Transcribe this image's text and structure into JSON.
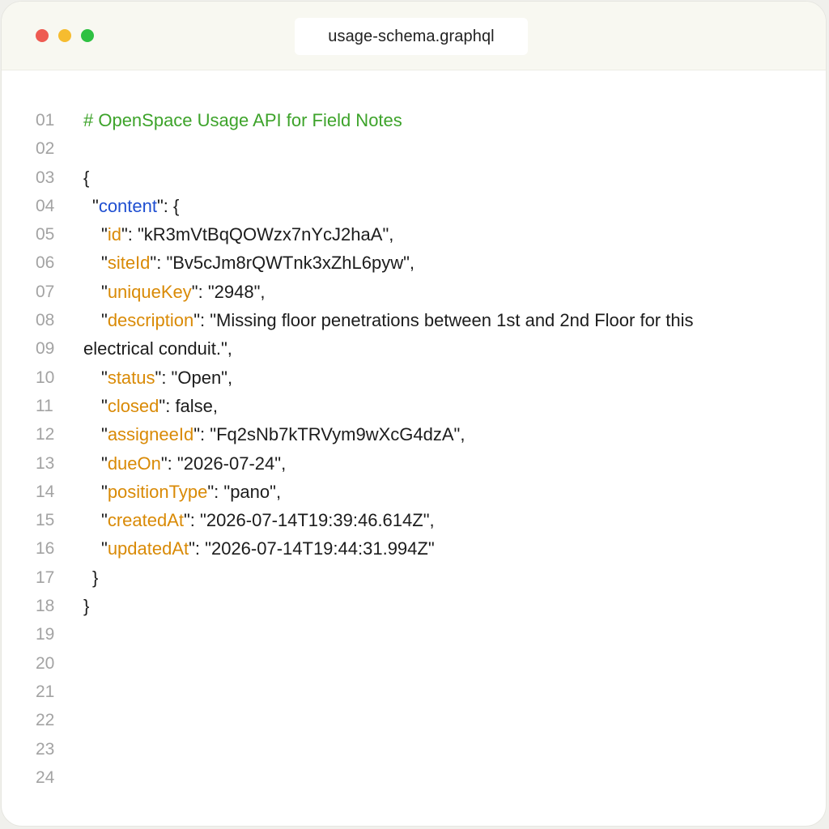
{
  "window": {
    "tab_title": "usage-schema.graphql",
    "colors": {
      "close": "#ee5b52",
      "minimize": "#f6bc2f",
      "maximize": "#2ec142"
    }
  },
  "editor": {
    "line_numbers": [
      "01",
      "02",
      "03",
      "04",
      "05",
      "06",
      "07",
      "08",
      "09",
      "10",
      "11",
      "12",
      "13",
      "14",
      "15",
      "16",
      "17",
      "18",
      "19",
      "20",
      "21",
      "22",
      "23",
      "24"
    ],
    "comment": "# OpenSpace Usage API for Field Notes",
    "open_brace": "{",
    "content_key": "content",
    "content_open": "\": {",
    "fields": {
      "id": {
        "key": "id",
        "value": "\": \"kR3mVtBqQOWzx7nYcJ2haA\","
      },
      "siteId": {
        "key": "siteId",
        "value": "\": \"Bv5cJm8rQWTnk3xZhL6pyw\","
      },
      "uniqueKey": {
        "key": "uniqueKey",
        "value": "\": \"2948\","
      },
      "description": {
        "key": "description",
        "value": "\": \"Missing floor penetrations between 1st and 2nd Floor for this",
        "continuation": "electrical conduit.\","
      },
      "status": {
        "key": "status",
        "value": "\": \"Open\","
      },
      "closed": {
        "key": "closed",
        "value": "\": false,"
      },
      "assigneeId": {
        "key": "assigneeId",
        "value": "\": \"Fq2sNb7kTRVym9wXcG4dzA\","
      },
      "dueOn": {
        "key": "dueOn",
        "value": "\": \"2026-07-24\","
      },
      "positionType": {
        "key": "positionType",
        "value": "\": \"pano\","
      },
      "createdAt": {
        "key": "createdAt",
        "value": "\": \"2026-07-14T19:39:46.614Z\","
      },
      "updatedAt": {
        "key": "updatedAt",
        "value": "\": \"2026-07-14T19:44:31.994Z\""
      }
    },
    "inner_close": "}",
    "outer_close": "}",
    "quote": "\""
  }
}
